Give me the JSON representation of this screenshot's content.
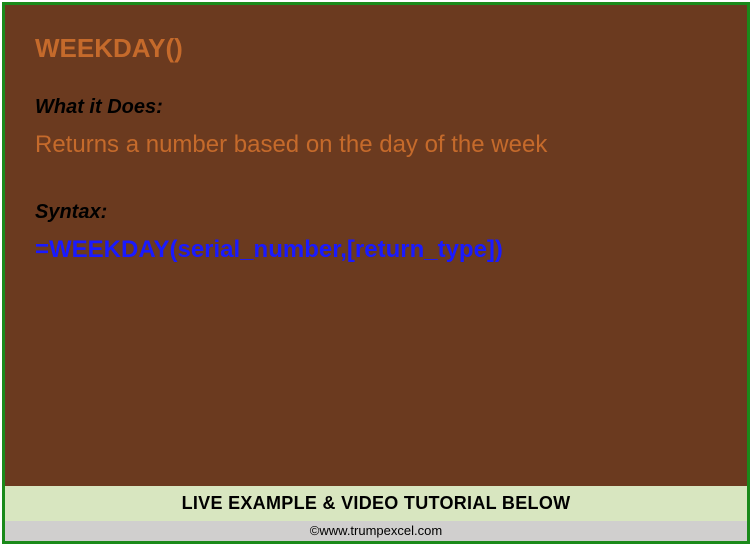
{
  "function_name": "WEEKDAY()",
  "what_label": "What it Does:",
  "description": "Returns a number based on the day of the week",
  "syntax_label": "Syntax:",
  "syntax_formula": "=WEEKDAY(serial_number,[return_type])",
  "banner_text": "LIVE EXAMPLE & VIDEO TUTORIAL BELOW",
  "footer_text": "©www.trumpexcel.com"
}
